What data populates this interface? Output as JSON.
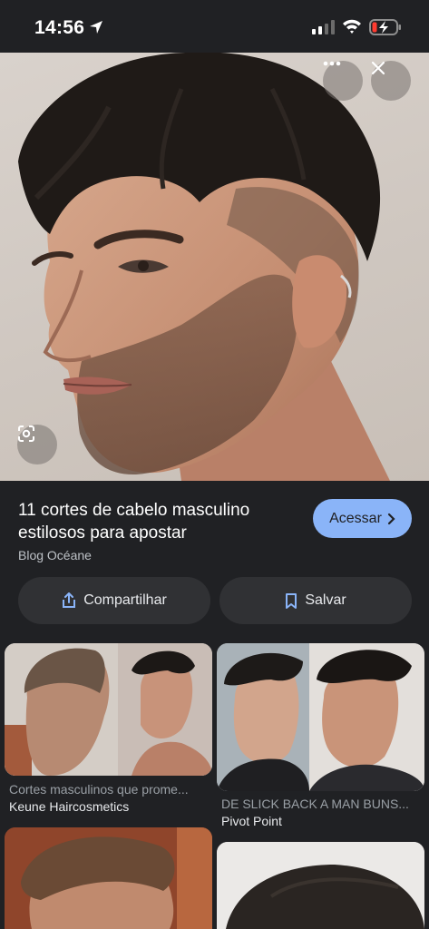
{
  "status": {
    "time": "14:56"
  },
  "image": {
    "description_icon": "lens-icon"
  },
  "result": {
    "title": "11 cortes de cabelo masculino estilosos para apostar",
    "source": "Blog Océane",
    "visit_label": "Acessar"
  },
  "actions": {
    "share_label": "Compartilhar",
    "save_label": "Salvar"
  },
  "related": [
    {
      "caption": "Cortes masculinos que prome...",
      "source": "Keune Haircosmetics"
    },
    {
      "caption": "DE SLICK BACK A MAN BUNS...",
      "source": "Pivot Point"
    }
  ],
  "colors": {
    "accent": "#8ab4f8",
    "background": "#202124",
    "surface": "#303134"
  }
}
